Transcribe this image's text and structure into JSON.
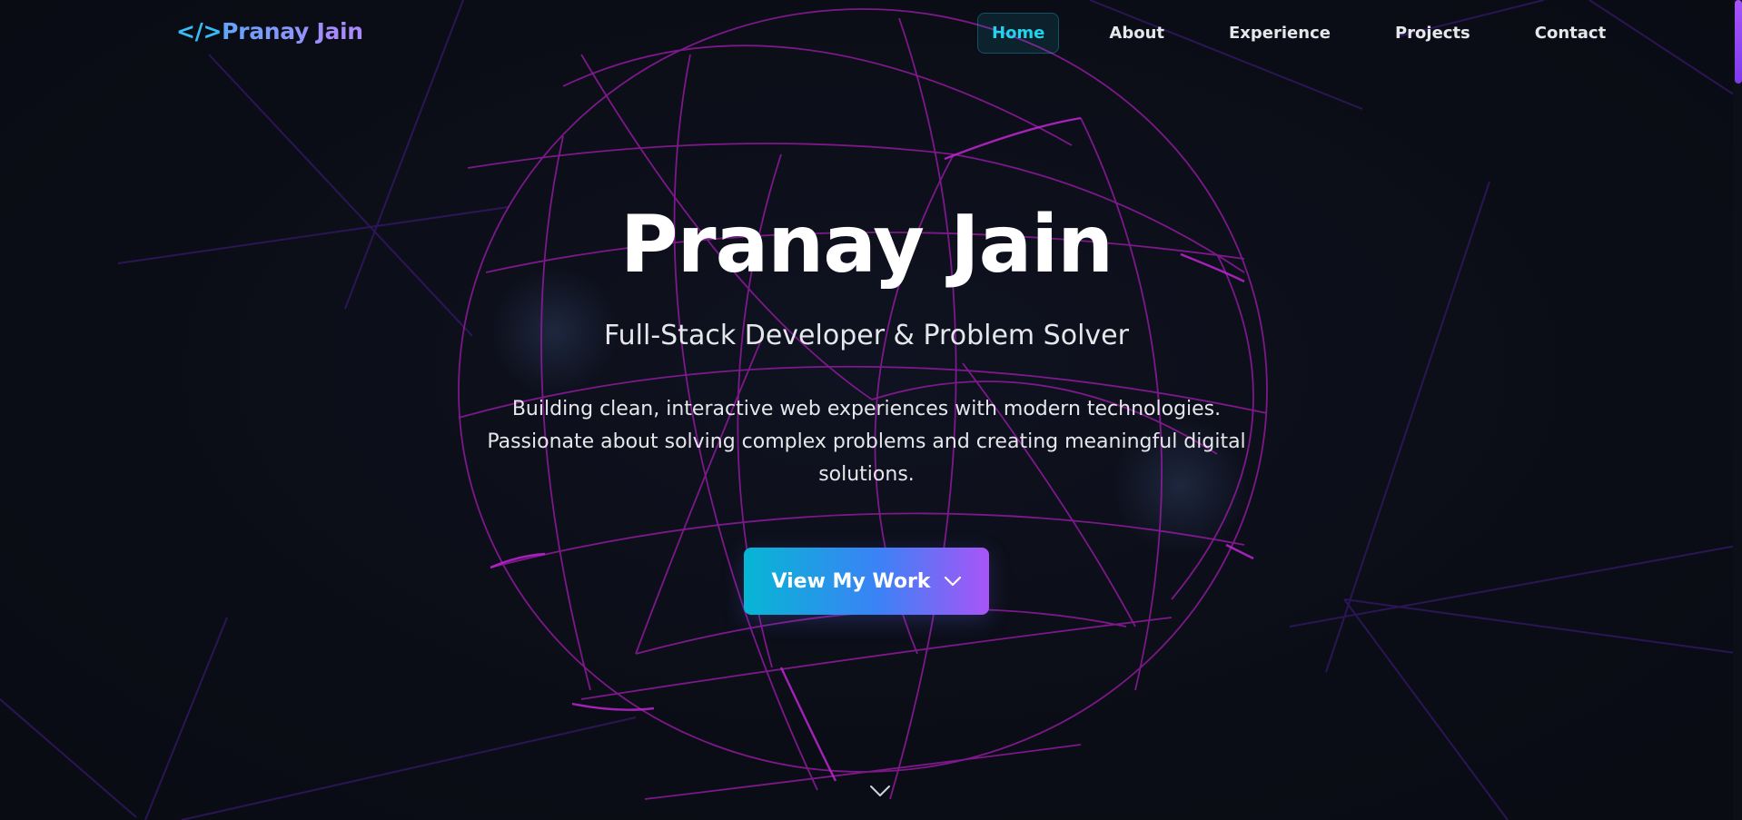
{
  "nav": {
    "logo_code": "</>",
    "logo_name": "Pranay Jain",
    "links": [
      {
        "label": "Home",
        "active": true
      },
      {
        "label": "About",
        "active": false
      },
      {
        "label": "Experience",
        "active": false
      },
      {
        "label": "Projects",
        "active": false
      },
      {
        "label": "Contact",
        "active": false
      }
    ]
  },
  "hero": {
    "title": "Pranay Jain",
    "subtitle": "Full-Stack Developer & Problem Solver",
    "description_line1": "Building clean, interactive web experiences with modern technologies.",
    "description_line2": "Passionate about solving complex problems and creating meaningful digital solutions.",
    "cta_label": "View My Work",
    "cta_icon": "chevron-down-icon",
    "scroll_icon": "chevron-down-icon"
  },
  "colors": {
    "background": "#0b0d16",
    "accent_cyan": "#22d3ee",
    "accent_purple": "#a855f7",
    "globe_line": "#a21caf",
    "text": "#f1f5f9"
  }
}
